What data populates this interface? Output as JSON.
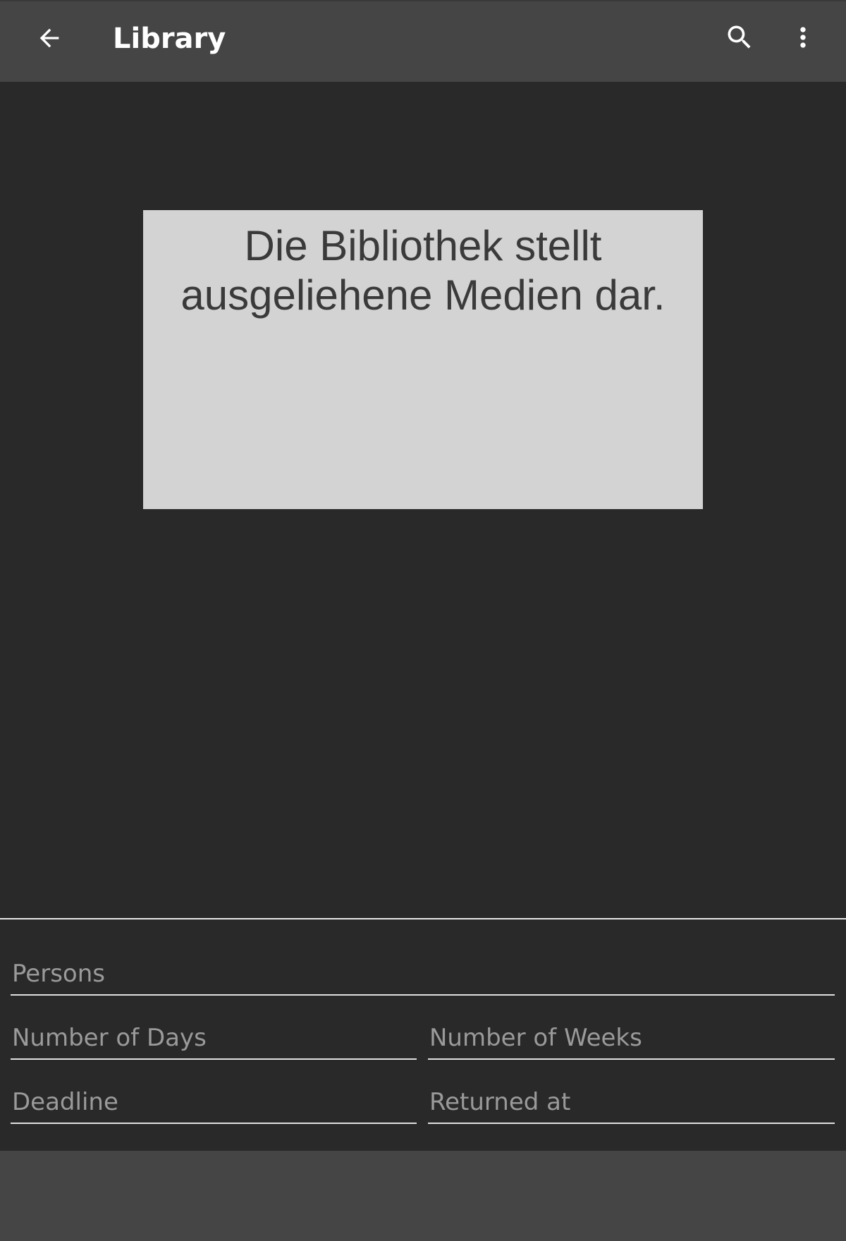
{
  "appbar": {
    "title": "Library",
    "back_icon": "arrow-back-icon",
    "search_icon": "search-icon",
    "more_icon": "more-vert-icon"
  },
  "image": {
    "caption": "Die Bibliothek stellt ausgeliehene Medien dar."
  },
  "form": {
    "persons": {
      "placeholder": "Persons",
      "value": ""
    },
    "days": {
      "placeholder": "Number of Days",
      "value": ""
    },
    "weeks": {
      "placeholder": "Number of Weeks",
      "value": ""
    },
    "deadline": {
      "placeholder": "Deadline",
      "value": ""
    },
    "returned": {
      "placeholder": "Returned at",
      "value": ""
    }
  },
  "colors": {
    "appbar": "#454545",
    "background": "#292929",
    "image_box": "#d3d3d3"
  }
}
